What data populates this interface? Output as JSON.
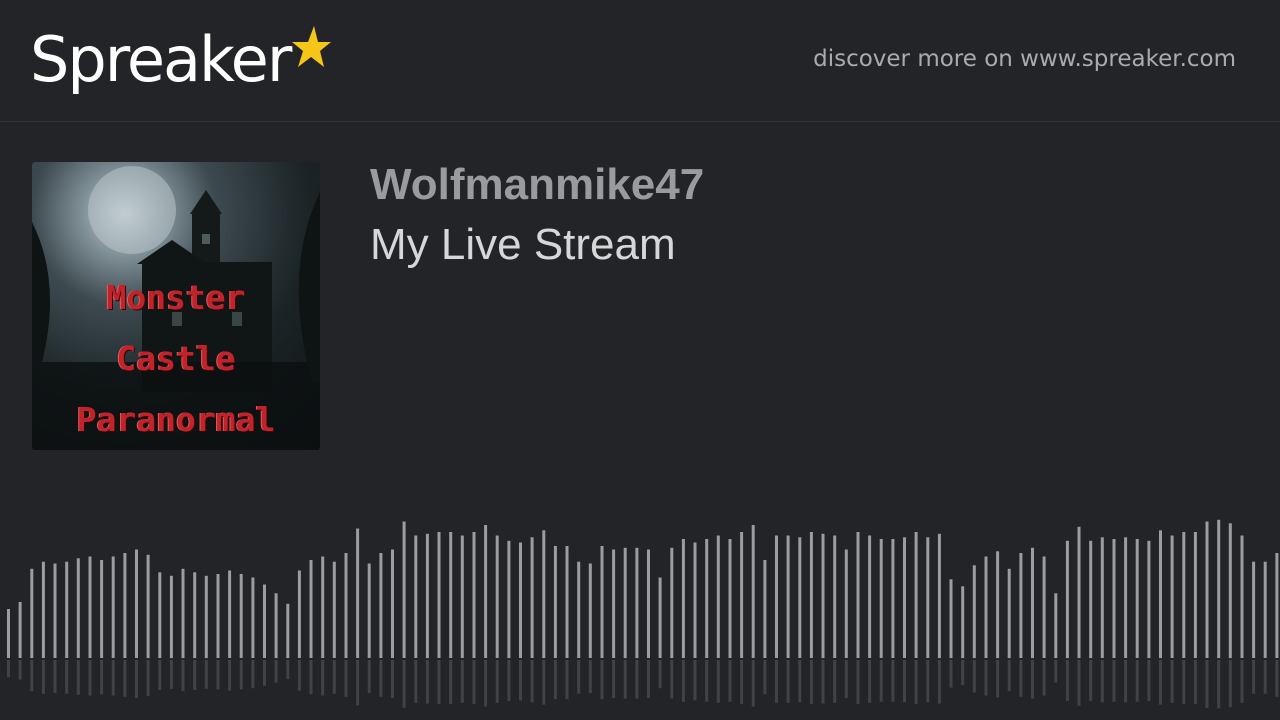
{
  "header": {
    "logo_text": "Spreaker",
    "logo_star_color": "#f5c518",
    "discover_text": "discover more on www.spreaker.com"
  },
  "episode": {
    "author": "Wolfmanmike47",
    "title": "My Live Stream",
    "cover": {
      "line1": "Monster",
      "line2": "Castle",
      "line3": "Paranormal"
    }
  },
  "waveform": {
    "color": "#9c9da0",
    "levels": [
      0.28,
      0.32,
      0.51,
      0.55,
      0.54,
      0.55,
      0.57,
      0.58,
      0.56,
      0.58,
      0.6,
      0.62,
      0.59,
      0.49,
      0.47,
      0.51,
      0.49,
      0.47,
      0.48,
      0.5,
      0.48,
      0.46,
      0.42,
      0.37,
      0.31,
      0.5,
      0.56,
      0.58,
      0.55,
      0.6,
      0.74,
      0.54,
      0.6,
      0.62,
      0.78,
      0.7,
      0.71,
      0.72,
      0.72,
      0.7,
      0.72,
      0.76,
      0.7,
      0.67,
      0.66,
      0.69,
      0.73,
      0.64,
      0.64,
      0.55,
      0.54,
      0.64,
      0.62,
      0.63,
      0.63,
      0.62,
      0.46,
      0.63,
      0.68,
      0.66,
      0.68,
      0.7,
      0.68,
      0.72,
      0.76,
      0.56,
      0.7,
      0.7,
      0.69,
      0.72,
      0.71,
      0.7,
      0.62,
      0.72,
      0.7,
      0.68,
      0.68,
      0.69,
      0.72,
      0.69,
      0.71,
      0.45,
      0.41,
      0.53,
      0.58,
      0.61,
      0.51,
      0.6,
      0.63,
      0.58,
      0.37,
      0.67,
      0.75,
      0.67,
      0.69,
      0.68,
      0.69,
      0.68,
      0.67,
      0.73,
      0.7,
      0.72,
      0.72,
      0.78,
      0.79,
      0.77,
      0.7,
      0.55,
      0.55,
      0.6
    ]
  }
}
